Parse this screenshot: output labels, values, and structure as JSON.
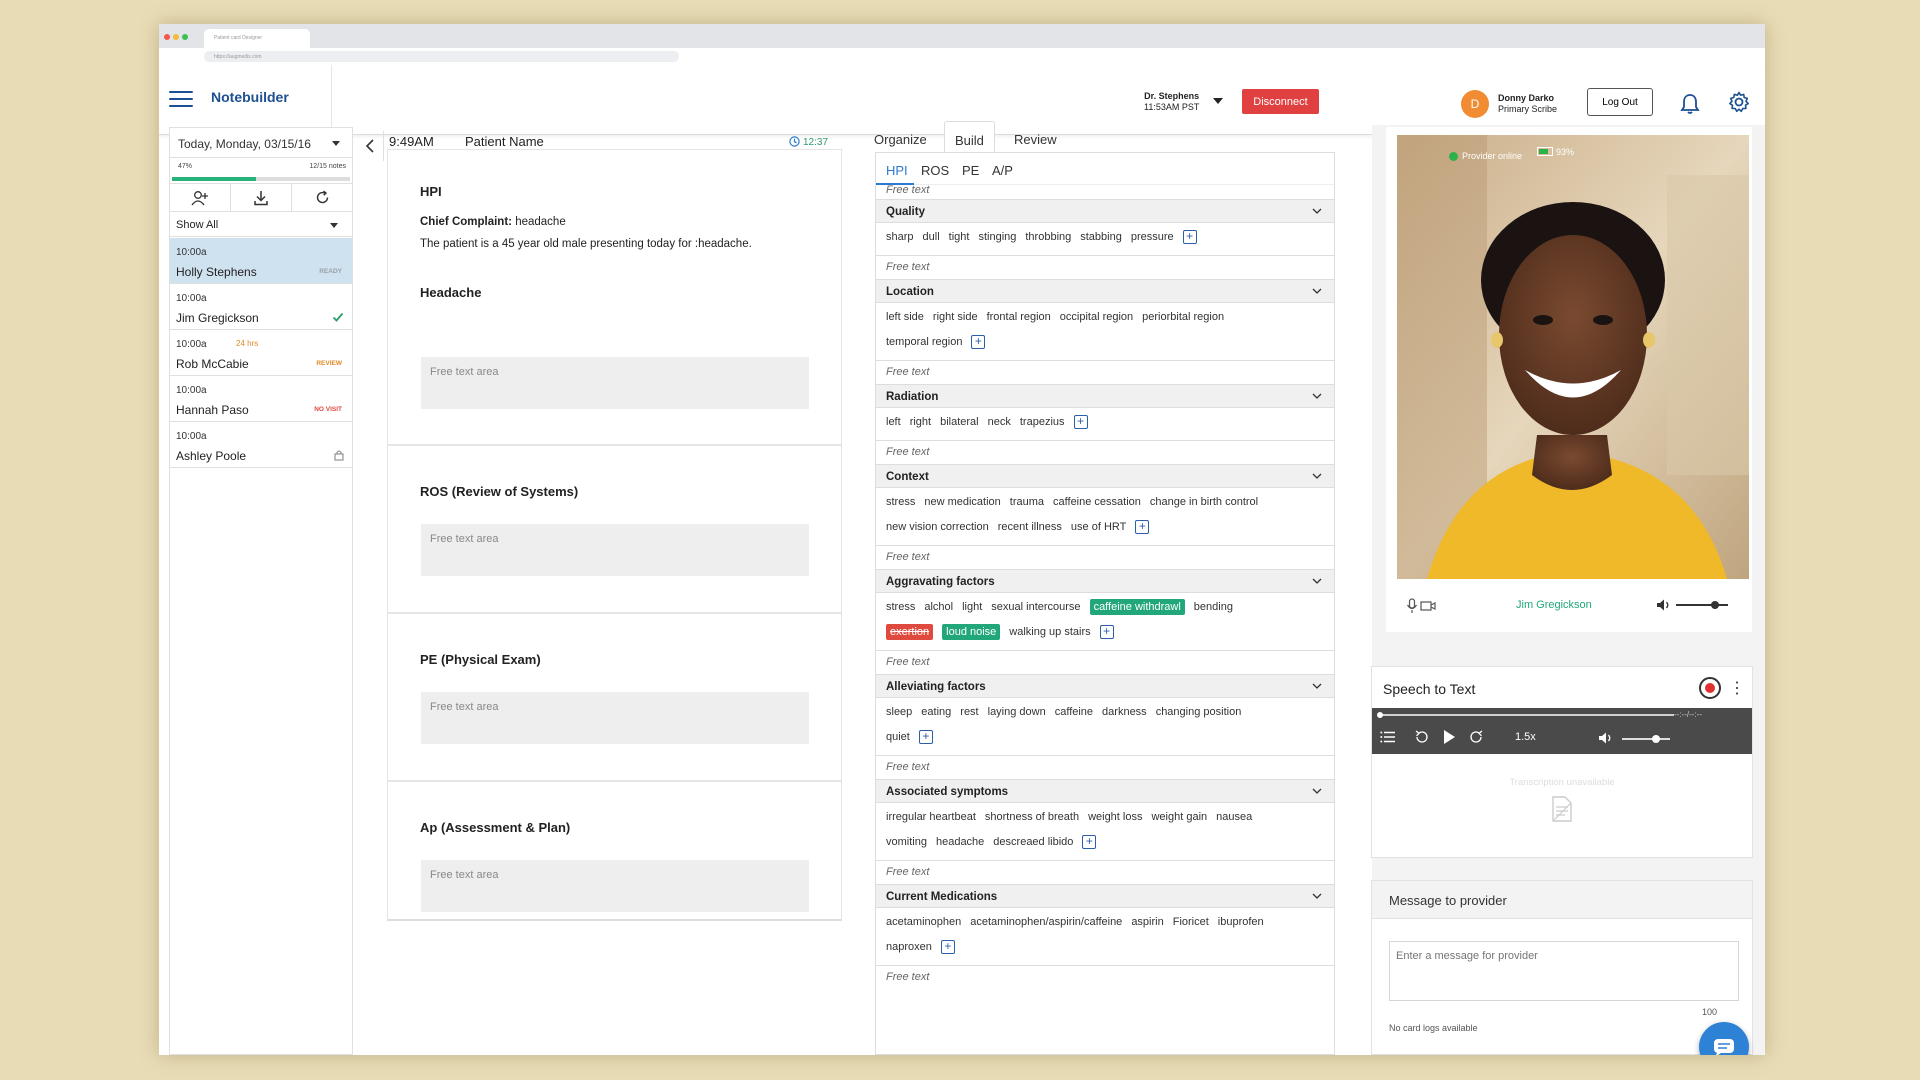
{
  "browser": {
    "tab_title": "Patient card Designer",
    "url": "https://augmedix.com"
  },
  "header": {
    "app_title": "Notebuilder",
    "provider_name": "Dr. Stephens",
    "provider_time": "11:53AM PST",
    "disconnect_label": "Disconnect",
    "avatar_initial": "D",
    "scribe_name": "Donny Darko",
    "scribe_role": "Primary Scribe",
    "logout_label": "Log Out"
  },
  "patients_panel": {
    "date_label": "Today, Monday, 03/15/16",
    "progress_pct_label": "47%",
    "progress_fraction": 0.47,
    "notes_label": "12/15 notes",
    "filter_label": "Show All",
    "patients": [
      {
        "time": "10:00a",
        "tag": "",
        "name": "Holly Stephens",
        "status": "READY",
        "status_color": "#9aa0a6"
      },
      {
        "time": "10:00a",
        "tag": "",
        "name": "Jim Gregickson",
        "status": "",
        "status_color": "#2f9a6a"
      },
      {
        "time": "10:00a",
        "tag": "24 hrs",
        "name": "Rob McCabie",
        "status": "REVIEW",
        "status_color": "#e08a2a"
      },
      {
        "time": "10:00a",
        "tag": "",
        "name": "Hannah Paso",
        "status": "NO VISIT",
        "status_color": "#e0493e"
      },
      {
        "time": "10:00a",
        "tag": "",
        "name": "Ashley Poole",
        "status": "",
        "status_color": "#888888"
      }
    ]
  },
  "note": {
    "time": "9:49AM",
    "patient_label": "Patient Name",
    "timer": "12:37",
    "hpi_title": "HPI",
    "chief_complaint_label": "Chief Complaint:",
    "chief_complaint_value": "headache",
    "hpi_sentence": "The patient is a 45 year old male presenting today for :headache.",
    "headache_title": "Headache",
    "ros_title": "ROS (Review of Systems)",
    "pe_title": "PE (Physical Exam)",
    "ap_title": "Ap (Assessment & Plan)",
    "free_text_area": "Free text area"
  },
  "builder": {
    "tabs": [
      "Organize",
      "Build",
      "Review"
    ],
    "subtabs": [
      "HPI",
      "ROS",
      "PE",
      "A/P"
    ],
    "free_text": "Free text",
    "sections": [
      {
        "title": "Quality",
        "lines": [
          [
            "sharp",
            "dull",
            "tight",
            "stinging",
            "throbbing",
            "stabbing",
            "pressure",
            "+"
          ]
        ]
      },
      {
        "title": "Location",
        "lines": [
          [
            "left side",
            "right side",
            "frontal region",
            "occipital region",
            "periorbital region"
          ],
          [
            "temporal region",
            "+"
          ]
        ]
      },
      {
        "title": "Radiation",
        "lines": [
          [
            "left",
            "right",
            "bilateral",
            "neck",
            "trapezius",
            "+"
          ]
        ]
      },
      {
        "title": "Context",
        "lines": [
          [
            "stress",
            "new medication",
            "trauma",
            "caffeine cessation",
            "change in birth control"
          ],
          [
            "new vision correction",
            "recent illness",
            "use of HRT",
            "+"
          ]
        ]
      },
      {
        "title": "Aggravating factors",
        "lines": [
          [
            "stress",
            "alchol",
            "light",
            "sexual intercourse",
            "caffeine withdrawl",
            "bending"
          ],
          [
            "exertion",
            "loud noise",
            "walking up stairs",
            "+"
          ]
        ]
      },
      {
        "title": "Alleviating factors",
        "lines": [
          [
            "sleep",
            "eating",
            "rest",
            "laying down",
            "caffeine",
            "darkness",
            "changing position"
          ],
          [
            "quiet",
            "+"
          ]
        ]
      },
      {
        "title": "Associated symptoms",
        "lines": [
          [
            "irregular heartbeat",
            "shortness of breath",
            "weight loss",
            "weight gain",
            "nausea"
          ],
          [
            "vomiting",
            "headache",
            "descreaed libido",
            "+"
          ]
        ]
      },
      {
        "title": "Current Medications",
        "lines": [
          [
            "acetaminophen",
            "acetaminophen/aspirin/caffeine",
            "aspirin",
            "Fioricet",
            "ibuprofen"
          ],
          [
            "naproxen",
            "+"
          ]
        ]
      }
    ],
    "selected_green": [
      "caffeine withdrawl",
      "loud noise"
    ],
    "selected_red": [
      "exertion"
    ]
  },
  "video": {
    "provider_status": "Provider online",
    "battery": "93%",
    "patient_name": "Jim Gregickson",
    "volume_level": 0.75
  },
  "speech_to_text": {
    "title": "Speech to Text",
    "time": "--:--/--:--",
    "speed": "1.5x",
    "unavailable": "Transcription unavailable",
    "volume_level": 0.7
  },
  "message": {
    "title": "Message to provider",
    "placeholder": "Enter a message for provider",
    "count": "100",
    "no_logs": "No card logs available"
  },
  "colors": {
    "brand_blue": "#1d4f91",
    "accent_green": "#22a77a",
    "alert_red": "#e0493e",
    "link_blue": "#2b7bd0"
  }
}
